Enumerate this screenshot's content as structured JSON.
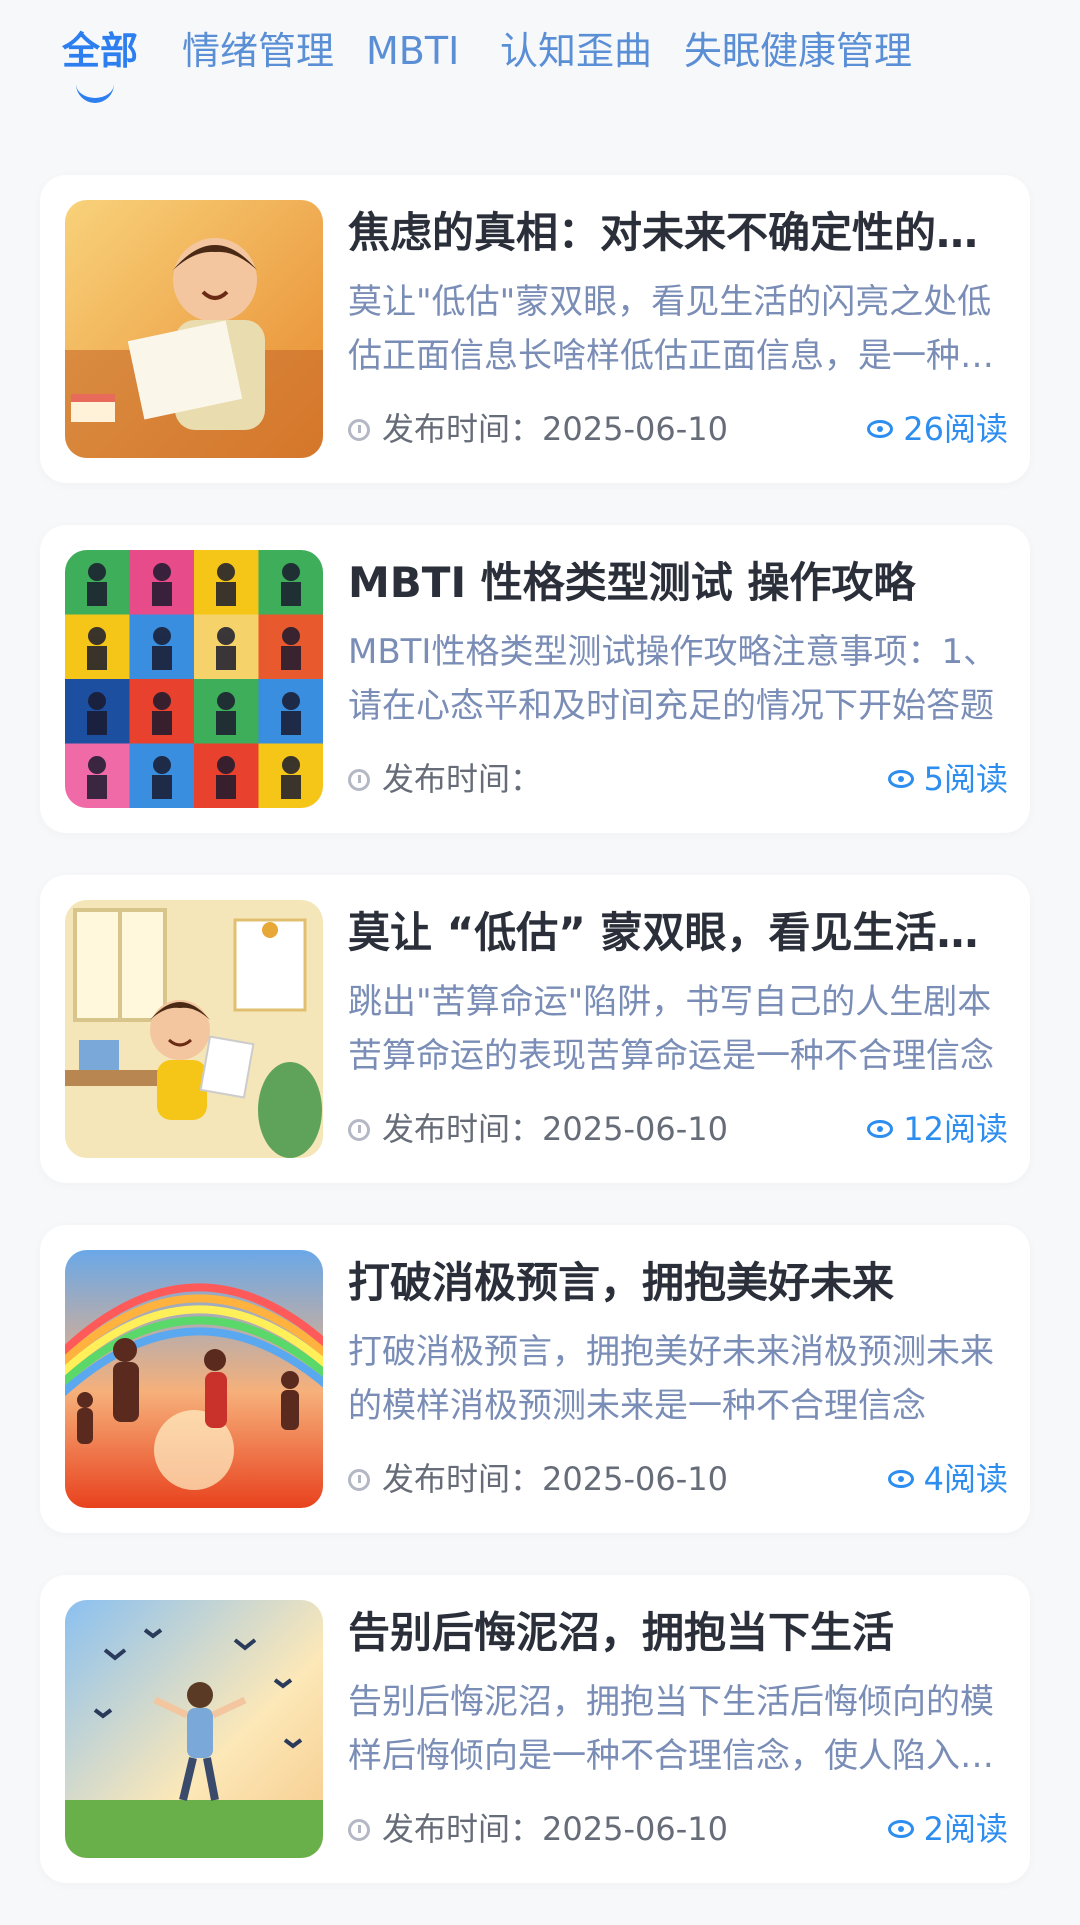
{
  "tabs": [
    {
      "label": "全部",
      "active": true
    },
    {
      "label": "情绪管理",
      "active": false
    },
    {
      "label": "MBTI",
      "active": false
    },
    {
      "label": "认知歪曲",
      "active": false
    },
    {
      "label": "失眠健康管理",
      "active": false
    }
  ],
  "accent_color": "#2d7ff0",
  "publish_label": "发布时间：",
  "articles": [
    {
      "title": "焦虑的真相：对未来不确定性的过度担忧",
      "desc": "莫让\"低估\"蒙双眼，看见生活的闪亮之处低估正面信息长啥样低估正面信息，是一种不合理信念",
      "date": "2025-06-10",
      "reads": "26阅读",
      "thumb": "boy-reading-book"
    },
    {
      "title": "MBTI 性格类型测试 操作攻略",
      "desc": "MBTI性格类型测试操作攻略注意事项：1、请在心态平和及时间充足的情况下开始答题",
      "date": "",
      "reads": "5阅读",
      "thumb": "mbti-character-grid"
    },
    {
      "title": "莫让 “低估” 蒙双眼，看见生活的闪亮之处",
      "desc": "跳出\"苦算命运\"陷阱，书写自己的人生剧本苦算命运的表现苦算命运是一种不合理信念",
      "date": "2025-06-10",
      "reads": "12阅读",
      "thumb": "boy-at-desk-calendar"
    },
    {
      "title": "打破消极预言，拥抱美好未来",
      "desc": "打破消极预言，拥抱美好未来消极预测未来的模样消极预测未来是一种不合理信念",
      "date": "2025-06-10",
      "reads": "4阅读",
      "thumb": "family-running-rainbow"
    },
    {
      "title": "告别后悔泥沼，拥抱当下生活",
      "desc": "告别后悔泥沼，拥抱当下生活后悔倾向的模样后悔倾向是一种不合理信念，使人陷入过去",
      "date": "2025-06-10",
      "reads": "2阅读",
      "thumb": "boy-running-birds"
    }
  ]
}
